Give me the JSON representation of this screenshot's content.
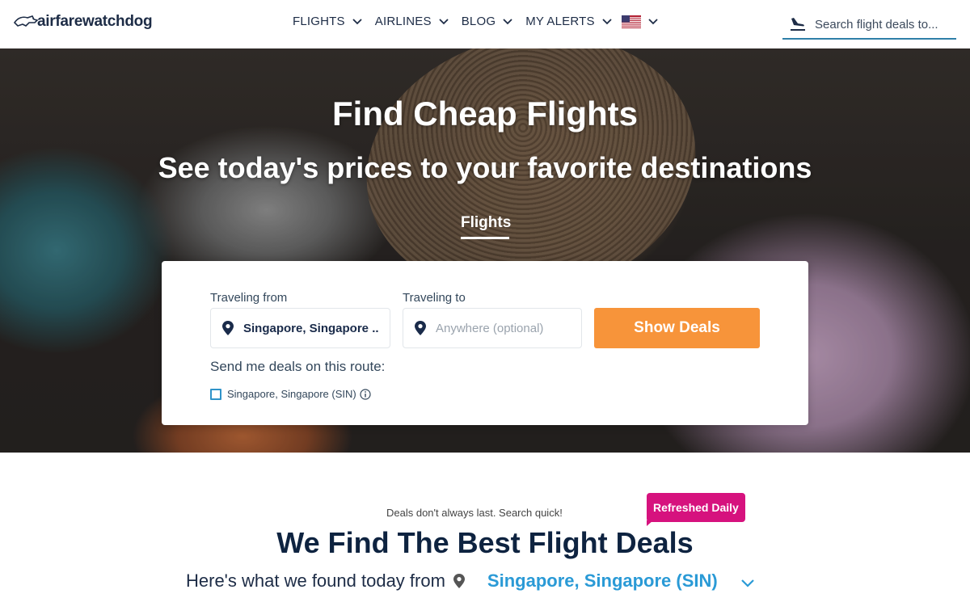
{
  "header": {
    "logo_text": "airfarewatchdog",
    "nav": [
      {
        "label": "FLIGHTS"
      },
      {
        "label": "AIRLINES"
      },
      {
        "label": "BLOG"
      },
      {
        "label": "MY ALERTS"
      }
    ],
    "search_placeholder": "Search flight deals to..."
  },
  "hero": {
    "title": "Find Cheap Flights",
    "subtitle": "See today's prices to your favorite destinations",
    "tab": "Flights"
  },
  "search_card": {
    "from_label": "Traveling from",
    "from_value": "Singapore, Singapore ..",
    "to_label": "Traveling to",
    "to_placeholder": "Anywhere (optional)",
    "button_label": "Show Deals",
    "send_label": "Send me deals on this route:",
    "checkbox_label": "Singapore, Singapore (SIN)"
  },
  "deals": {
    "note": "Deals don't always last. Search quick!",
    "badge": "Refreshed Daily",
    "title": "We Find The Best Flight Deals",
    "found_text": "Here's what we found today from",
    "found_city": "Singapore, Singapore (SIN)"
  },
  "colors": {
    "accent_orange": "#f7943a",
    "link_blue": "#2a9ad6",
    "badge_pink": "#d6127e",
    "navy": "#0e2340"
  },
  "icons": [
    "dog-logo-icon",
    "chevron-down-icon",
    "us-flag-icon",
    "plane-landing-icon",
    "location-pin-icon",
    "info-icon"
  ]
}
